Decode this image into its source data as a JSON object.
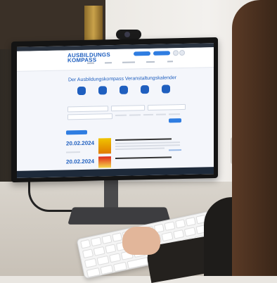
{
  "website": {
    "logo_line1": "AUSBILDUNGS",
    "logo_line2": "KOMPASS",
    "page_title": "Der Ausbildungskompass Veranstaltungskalender",
    "dates": [
      "20.02.2024",
      "20.02.2024"
    ]
  },
  "colors": {
    "brand_blue": "#1f5fbf",
    "button_blue": "#2f7de1"
  }
}
